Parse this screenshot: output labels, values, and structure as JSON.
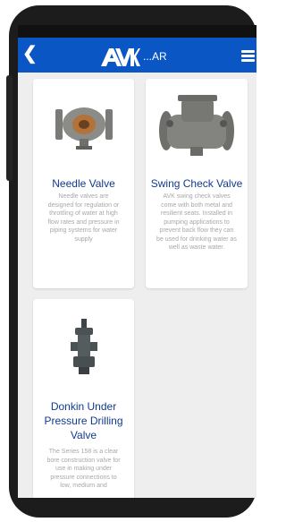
{
  "header": {
    "back_icon": "chevron-left-icon",
    "brand": "AVK",
    "brand_suffix": "...AR",
    "menu_icon": "hamburger-menu-icon",
    "bar_color": "#0a56c4"
  },
  "products": [
    {
      "title": "Needle Valve",
      "description": "Needle valves are designed for regulation or throttling of water at high flow rates and pressure in piping systems for water supply"
    },
    {
      "title": "Swing Check Valve",
      "description": "AVK swing check valves come with both metal and resilient seats. Installed in pumping applications to prevent back flow they can be used for drinking water as well as waste water."
    },
    {
      "title": "Donkin Under Pressure Drilling Valve",
      "description": "The Series 158 is a clear bore construction valve for use in making under pressure connections to low, medium and"
    }
  ]
}
